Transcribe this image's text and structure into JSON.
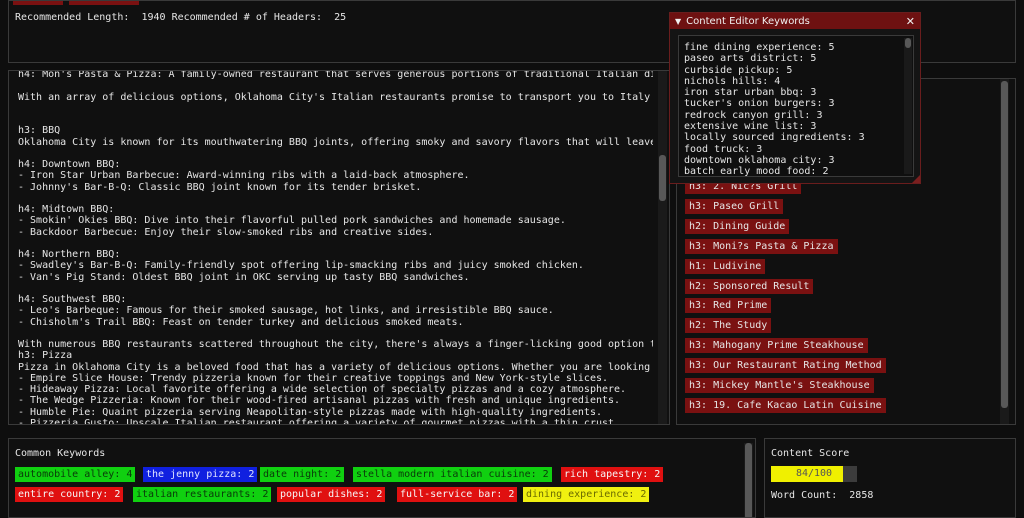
{
  "top": {
    "recommended_length_label": "Recommended Length:",
    "recommended_length": "1940",
    "recommended_headers_label": "Recommended # of Headers:",
    "recommended_headers": "25"
  },
  "editor_lines": [
    "h4: Mon's Pasta & Pizza: A family-owned restaurant that serves generous portions of traditional Italian dis",
    "",
    "With an array of delicious options, Oklahoma City's Italian restaurants promise to transport you to Italy",
    "",
    "",
    "h3: BBQ",
    "Oklahoma City is known for its mouthwatering BBQ joints, offering smoky and savory flavors that will leave",
    "",
    "h4: Downtown BBQ:",
    "- Iron Star Urban Barbecue: Award-winning ribs with a laid-back atmosphere.",
    "- Johnny's Bar-B-Q: Classic BBQ joint known for its tender brisket.",
    "",
    "h4: Midtown BBQ:",
    "- Smokin' Okies BBQ: Dive into their flavorful pulled pork sandwiches and homemade sausage.",
    "- Backdoor Barbecue: Enjoy their slow-smoked ribs and creative sides.",
    "",
    "h4: Northern BBQ:",
    "- Swadley's Bar-B-Q: Family-friendly spot offering lip-smacking ribs and juicy smoked chicken.",
    "- Van's Pig Stand: Oldest BBQ joint in OKC serving up tasty BBQ sandwiches.",
    "",
    "h4: Southwest BBQ:",
    "- Leo's Barbeque: Famous for their smoked sausage, hot links, and irresistible BBQ sauce.",
    "- Chisholm's Trail BBQ: Feast on tender turkey and delicious smoked meats.",
    "",
    "With numerous BBQ restaurants scattered throughout the city, there's always a finger-licking good option t",
    "h3: Pizza",
    "Pizza in Oklahoma City is a beloved food that has a variety of delicious options. Whether you are looking",
    "- Empire Slice House: Trendy pizzeria known for their creative toppings and New York-style slices.",
    "- Hideaway Pizza: Local favorite offering a wide selection of specialty pizzas and a cozy atmosphere.",
    "- The Wedge Pizzeria: Known for their wood-fired artisanal pizzas with fresh and unique ingredients.",
    "- Humble Pie: Quaint pizzeria serving Neapolitan-style pizzas made with high-quality ingredients.",
    "- Pizzeria Gusto: Upscale Italian restaurant offering a variety of gourmet pizzas with a thin crust."
  ],
  "keywords_window": {
    "title": "Content Editor Keywords",
    "items": [
      "fine dining experience: 5",
      "paseo arts district: 5",
      "curbside pickup: 5",
      "nichols hills: 4",
      "iron star urban bbq: 3",
      "tucker's onion burgers: 3",
      "redrock canyon grill: 3",
      "extensive wine list: 3",
      "locally sourced ingredients: 3",
      "food truck: 3",
      "downtown oklahoma city: 3",
      "batch early mood food: 2"
    ]
  },
  "headers": [
    "h3: 2. Nic?s Grill",
    "h3: Paseo Grill",
    "h2: Dining Guide",
    "h3: Moni?s Pasta & Pizza",
    "h1: Ludivine",
    "h2: Sponsored Result",
    "h3: Red Prime",
    "h2: The Study",
    "h3: Mahogany Prime Steakhouse",
    "h3: Our Restaurant Rating Method",
    "h3: Mickey Mantle's Steakhouse",
    "h3: 19. Cafe Kacao Latin Cuisine"
  ],
  "common_keywords": {
    "title": "Common Keywords",
    "row1": [
      {
        "text": "automobile alley: 4",
        "color": "green"
      },
      {
        "text": "the jenny pizza: 2",
        "color": "blue"
      },
      {
        "text": "date night: 2",
        "color": "green"
      },
      {
        "text": "stella modern italian cuisine: 2",
        "color": "green"
      },
      {
        "text": "rich tapestry: 2",
        "color": "red"
      }
    ],
    "row2": [
      {
        "text": "entire country: 2",
        "color": "red"
      },
      {
        "text": "italian restaurants: 2",
        "color": "green"
      },
      {
        "text": "popular dishes: 2",
        "color": "red"
      },
      {
        "text": "full-service bar: 2",
        "color": "red"
      },
      {
        "text": "dining experience: 2",
        "color": "yellow"
      }
    ],
    "colors": {
      "green": "#10d010",
      "red": "#e01010",
      "blue": "#1020e0",
      "yellow": "#f0f010"
    }
  },
  "content_score": {
    "title": "Content Score",
    "score_text": "84/100",
    "score_fraction": 0.84,
    "word_count_label": "Word Count:",
    "word_count": "2858"
  }
}
